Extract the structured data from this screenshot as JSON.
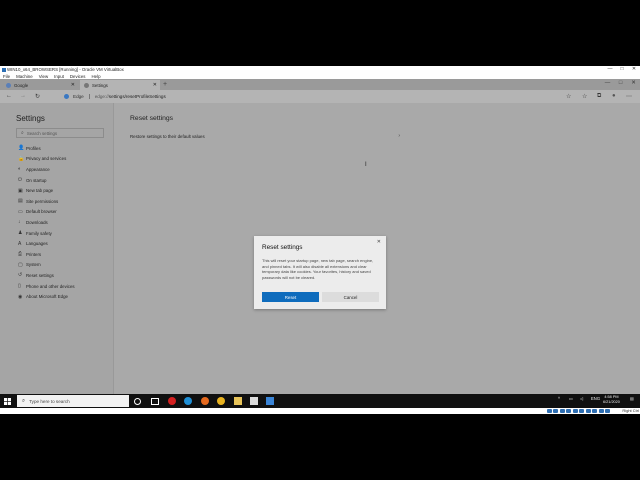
{
  "vbox": {
    "title": "WIN10_x64_BROWSERS [Running] - Oracle VM VirtualBox",
    "menu": [
      "File",
      "Machine",
      "View",
      "Input",
      "Devices",
      "Help"
    ],
    "controls": {
      "minimize": "—",
      "maximize": "□",
      "close": "✕"
    },
    "host_key": "Right Ctrl"
  },
  "browser": {
    "tabs": [
      {
        "label": "Google",
        "close": "✕"
      },
      {
        "label": "Settings",
        "close": "✕"
      }
    ],
    "new_tab": "+",
    "address": {
      "site_label": "Edge",
      "url_prefix": "edge://",
      "url_rest": "settings/resetProfileSettings"
    },
    "nav": {
      "back": "←",
      "forward": "→",
      "refresh": "↻"
    },
    "toolbar": {
      "favorite": "☆",
      "favorites": "☆",
      "collections": "⧉",
      "profile": "●",
      "more": "⋯"
    }
  },
  "settings": {
    "title": "Settings",
    "search_placeholder": "Search settings",
    "nav_items": [
      {
        "label": "Profiles",
        "icon": "👤"
      },
      {
        "label": "Privacy and services",
        "icon": "🔒"
      },
      {
        "label": "Appearance",
        "icon": "◐"
      },
      {
        "label": "On startup",
        "icon": "⏻"
      },
      {
        "label": "New tab page",
        "icon": "▣"
      },
      {
        "label": "Site permissions",
        "icon": "▤"
      },
      {
        "label": "Default browser",
        "icon": "▭"
      },
      {
        "label": "Downloads",
        "icon": "↓"
      },
      {
        "label": "Family safety",
        "icon": "♟"
      },
      {
        "label": "Languages",
        "icon": "A"
      },
      {
        "label": "Printers",
        "icon": "⎙"
      },
      {
        "label": "System",
        "icon": "▢"
      },
      {
        "label": "Reset settings",
        "icon": "↺"
      },
      {
        "label": "Phone and other devices",
        "icon": "▯"
      },
      {
        "label": "About Microsoft Edge",
        "icon": "◉"
      }
    ],
    "main_title": "Reset settings",
    "restore_label": "Restore settings to their default values",
    "restore_chevron": "›"
  },
  "dialog": {
    "title": "Reset settings",
    "close": "✕",
    "body": "This will reset your startup page, new tab page, search engine, and pinned tabs. It will also disable all extensions and clear temporary data like cookies. Your favorites, history and saved passwords will not be cleared.",
    "reset_label": "Reset",
    "cancel_label": "Cancel"
  },
  "taskbar": {
    "search_placeholder": "Type here to search",
    "language": "ENG",
    "time": "4:58 PM",
    "date": "6/21/2020"
  },
  "colors": {
    "accent": "#0f6cbd",
    "overlay_gray": "#a9a9a9",
    "taskbar": "#101010"
  }
}
